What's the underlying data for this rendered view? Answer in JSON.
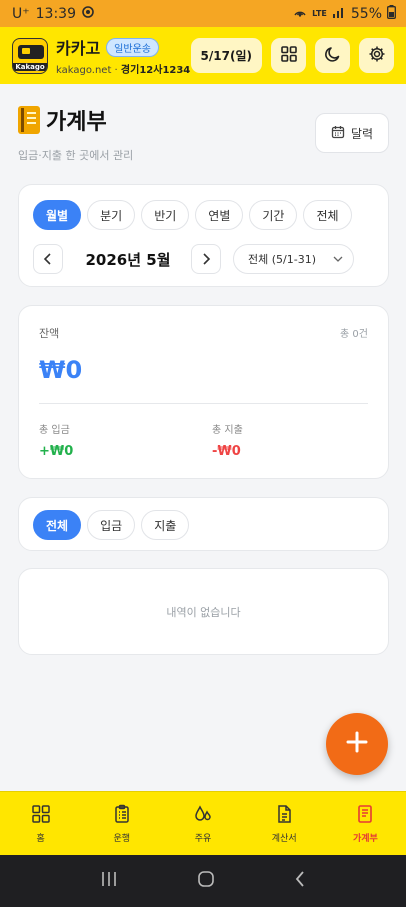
{
  "status_bar": {
    "carrier": "U⁺",
    "time": "13:39",
    "network": "LTE",
    "battery": "55%"
  },
  "header": {
    "logo_text": "Kakago",
    "brand_name": "카카고",
    "badge": "일반운송",
    "site": "kakago.net",
    "plate": "경기12사1234",
    "date_button": "5/17(일)",
    "icons": [
      "grid-icon",
      "moon-icon",
      "gear-icon"
    ]
  },
  "page": {
    "title": "가계부",
    "subtitle": "입금·지출 한 곳에서 관리",
    "calendar_button": "달력"
  },
  "period": {
    "tabs": [
      {
        "label": "월별",
        "active": true
      },
      {
        "label": "분기",
        "active": false
      },
      {
        "label": "반기",
        "active": false
      },
      {
        "label": "연별",
        "active": false
      },
      {
        "label": "기간",
        "active": false
      },
      {
        "label": "전체",
        "active": false
      }
    ],
    "month_label": "2026년 5월",
    "range_label": "전체 (5/1-31)"
  },
  "balance": {
    "label": "잔액",
    "count": "총 0건",
    "value": "₩0",
    "income_label": "총 입금",
    "income_value": "+₩0",
    "expense_label": "총 지출",
    "expense_value": "-₩0"
  },
  "filter": {
    "tabs": [
      {
        "label": "전체",
        "active": true
      },
      {
        "label": "입금",
        "active": false
      },
      {
        "label": "지출",
        "active": false
      }
    ]
  },
  "list": {
    "empty_text": "내역이 없습니다"
  },
  "bottom_nav": {
    "items": [
      {
        "label": "홈",
        "icon": "home-grid-icon",
        "active": false
      },
      {
        "label": "운행",
        "icon": "clipboard-icon",
        "active": false
      },
      {
        "label": "주유",
        "icon": "fuel-drop-icon",
        "active": false
      },
      {
        "label": "계산서",
        "icon": "document-icon",
        "active": false
      },
      {
        "label": "가계부",
        "icon": "ledger-icon",
        "active": true
      }
    ]
  },
  "colors": {
    "accent": "#3b82f6",
    "header": "#ffe600",
    "fab": "#f26b16",
    "income": "#22b14c",
    "expense": "#ef4444"
  }
}
